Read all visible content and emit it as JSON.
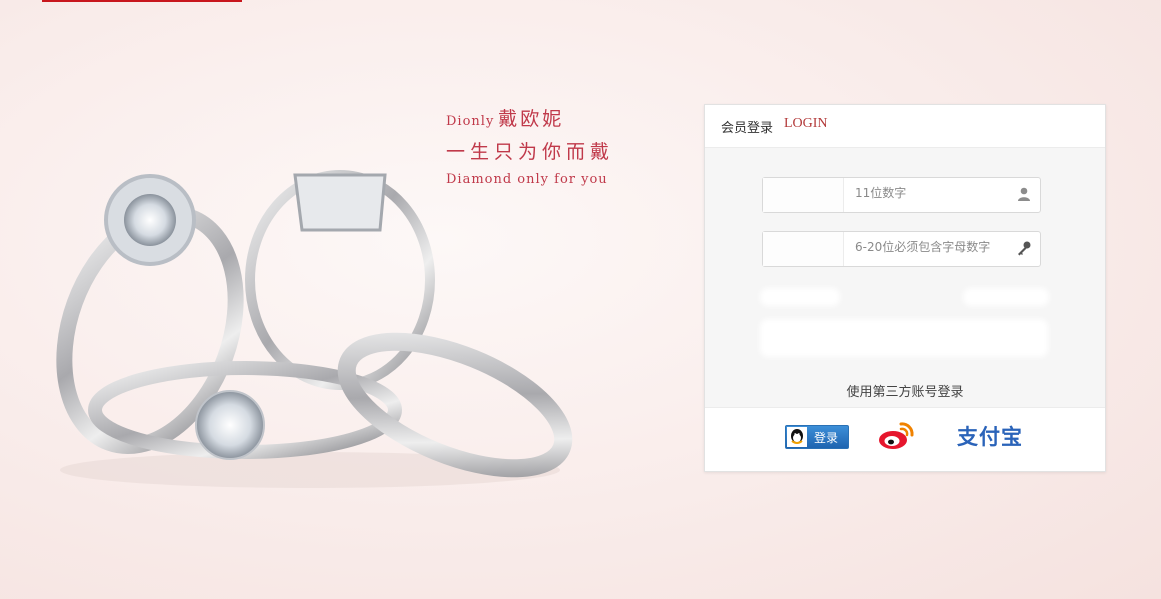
{
  "slogan": {
    "brand_en": "Dionly",
    "brand_cn": "戴欧妮",
    "line2": "一生只为你而戴",
    "line3": "Diamond only for you"
  },
  "login": {
    "title": "会员登录",
    "title_en": "LOGIN",
    "phone_placeholder": "11位数字",
    "password_placeholder": "6-20位必须包含字母数字",
    "third_party_label": "使用第三方账号登录",
    "qq_login_label": "登录",
    "alipay_label": "支付宝"
  },
  "icons": {
    "user": "user-icon",
    "key": "key-icon",
    "qq": "qq-icon",
    "weibo": "weibo-icon",
    "alipay": "alipay-logo"
  },
  "colors": {
    "brand_red": "#c8161d",
    "slogan_red": "#c0394a",
    "login_en_red": "#b33a3a",
    "qq_blue": "#1e64b0",
    "alipay_blue": "#2a63b9",
    "weibo_red": "#e6162d"
  }
}
